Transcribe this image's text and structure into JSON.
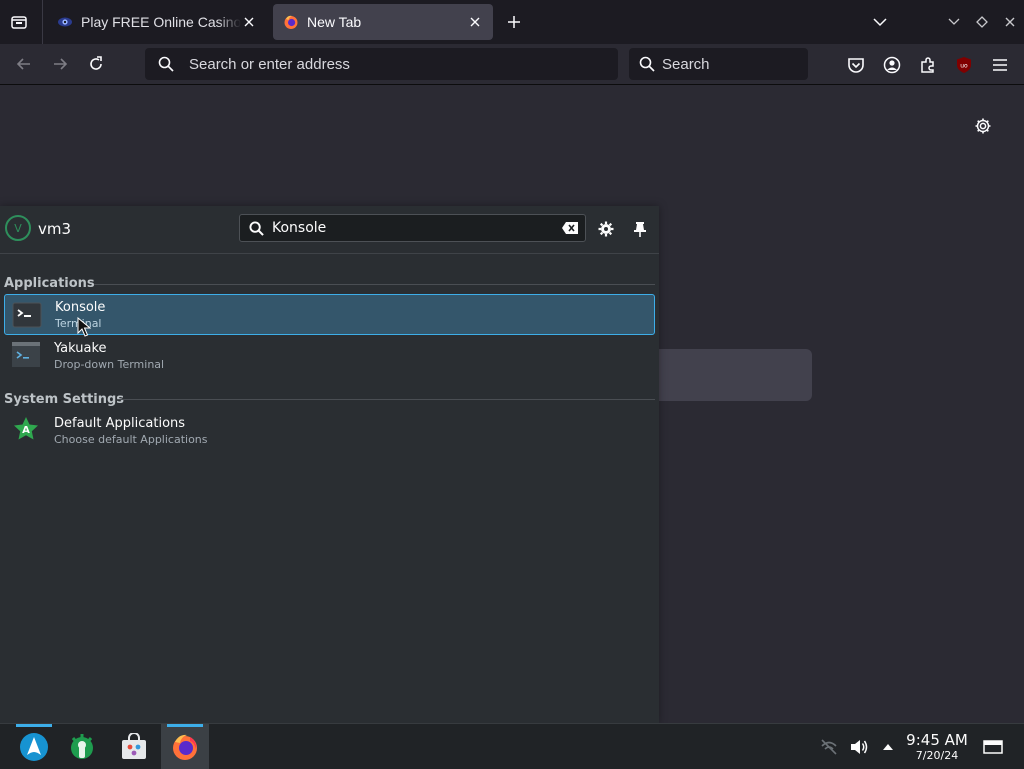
{
  "browser": {
    "tabs": [
      {
        "title": "Play FREE Online Casino g",
        "favicon": "casino-eye-icon",
        "active": false
      },
      {
        "title": "New Tab",
        "favicon": "firefox-icon",
        "active": true
      }
    ],
    "address_placeholder": "Search or enter address",
    "search_placeholder": "Search",
    "toolbar_icons": [
      "pocket-icon",
      "account-icon",
      "extensions-icon",
      "ublock-icon",
      "menu-icon"
    ],
    "accent": "#3daee9"
  },
  "launcher": {
    "username": "vm3",
    "avatar_letter": "V",
    "query": "Konsole",
    "sections": [
      {
        "title": "Applications",
        "results": [
          {
            "title": "Konsole",
            "subtitle": "Terminal",
            "icon": "konsole-icon",
            "selected": true
          },
          {
            "title": "Yakuake",
            "subtitle": "Drop-down Terminal",
            "icon": "yakuake-icon",
            "selected": false
          }
        ]
      },
      {
        "title": "System Settings",
        "results": [
          {
            "title": "Default Applications",
            "subtitle": "Choose default Applications",
            "icon": "default-apps-icon",
            "selected": false
          }
        ]
      }
    ]
  },
  "taskbar": {
    "apps": [
      "arch-launcher-icon",
      "settings-wrench-icon",
      "store-icon",
      "firefox-icon"
    ],
    "clock": {
      "time": "9:45 AM",
      "date": "7/20/24"
    }
  }
}
